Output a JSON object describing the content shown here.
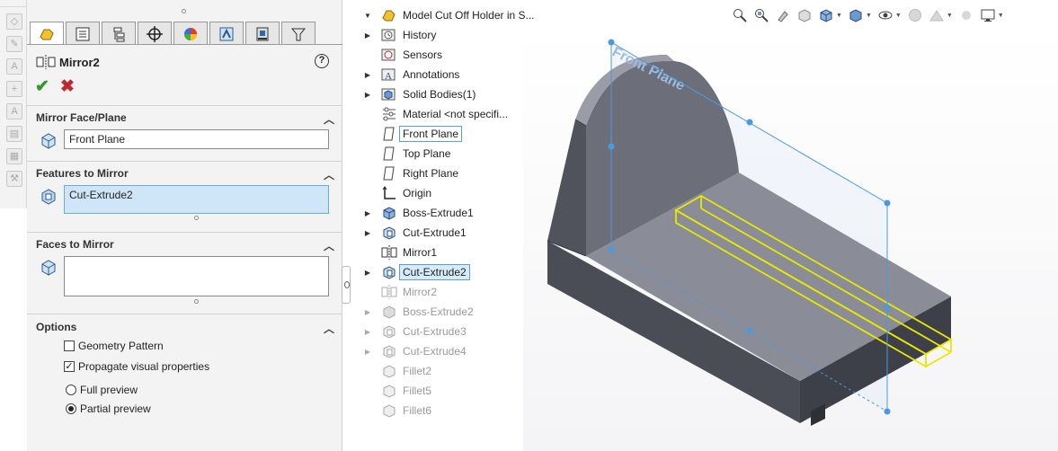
{
  "property_manager": {
    "title": "Mirror2",
    "help_glyph": "?",
    "ok_glyph": "✔",
    "cancel_glyph": "✖",
    "tabs": [
      "feature-manager-tab",
      "property-manager-tab",
      "configuration-manager-tab",
      "dimxpert-manager-tab",
      "display-manager-tab",
      "cam-tab",
      "simulation-tab",
      "design-checker-tab"
    ],
    "mirror_face": {
      "header": "Mirror Face/Plane",
      "value": "Front Plane"
    },
    "features": {
      "header": "Features to Mirror",
      "value": "Cut-Extrude2"
    },
    "faces": {
      "header": "Faces to Mirror",
      "value": ""
    },
    "options": {
      "header": "Options",
      "geometry_pattern": "Geometry Pattern",
      "propagate": "Propagate visual properties",
      "full_preview": "Full preview",
      "partial_preview": "Partial preview"
    }
  },
  "tree": {
    "root": "Model Cut Off Holder in S...",
    "items": [
      {
        "label": "History"
      },
      {
        "label": "Sensors"
      },
      {
        "label": "Annotations"
      },
      {
        "label": "Solid Bodies(1)"
      },
      {
        "label": "Material <not specifi..."
      },
      {
        "label": "Front Plane"
      },
      {
        "label": "Top Plane"
      },
      {
        "label": "Right Plane"
      },
      {
        "label": "Origin"
      },
      {
        "label": "Boss-Extrude1"
      },
      {
        "label": "Cut-Extrude1"
      },
      {
        "label": "Mirror1"
      },
      {
        "label": "Cut-Extrude2"
      },
      {
        "label": "Mirror2"
      },
      {
        "label": "Boss-Extrude2"
      },
      {
        "label": "Cut-Extrude3"
      },
      {
        "label": "Cut-Extrude4"
      },
      {
        "label": "Fillet2"
      },
      {
        "label": "Fillet5"
      },
      {
        "label": "Fillet6"
      }
    ]
  },
  "viewport": {
    "plane_label": "Front Plane"
  },
  "colors": {
    "accent": "#5a9fd4",
    "highlight": "#e8e800",
    "part": "#6a6c78"
  }
}
